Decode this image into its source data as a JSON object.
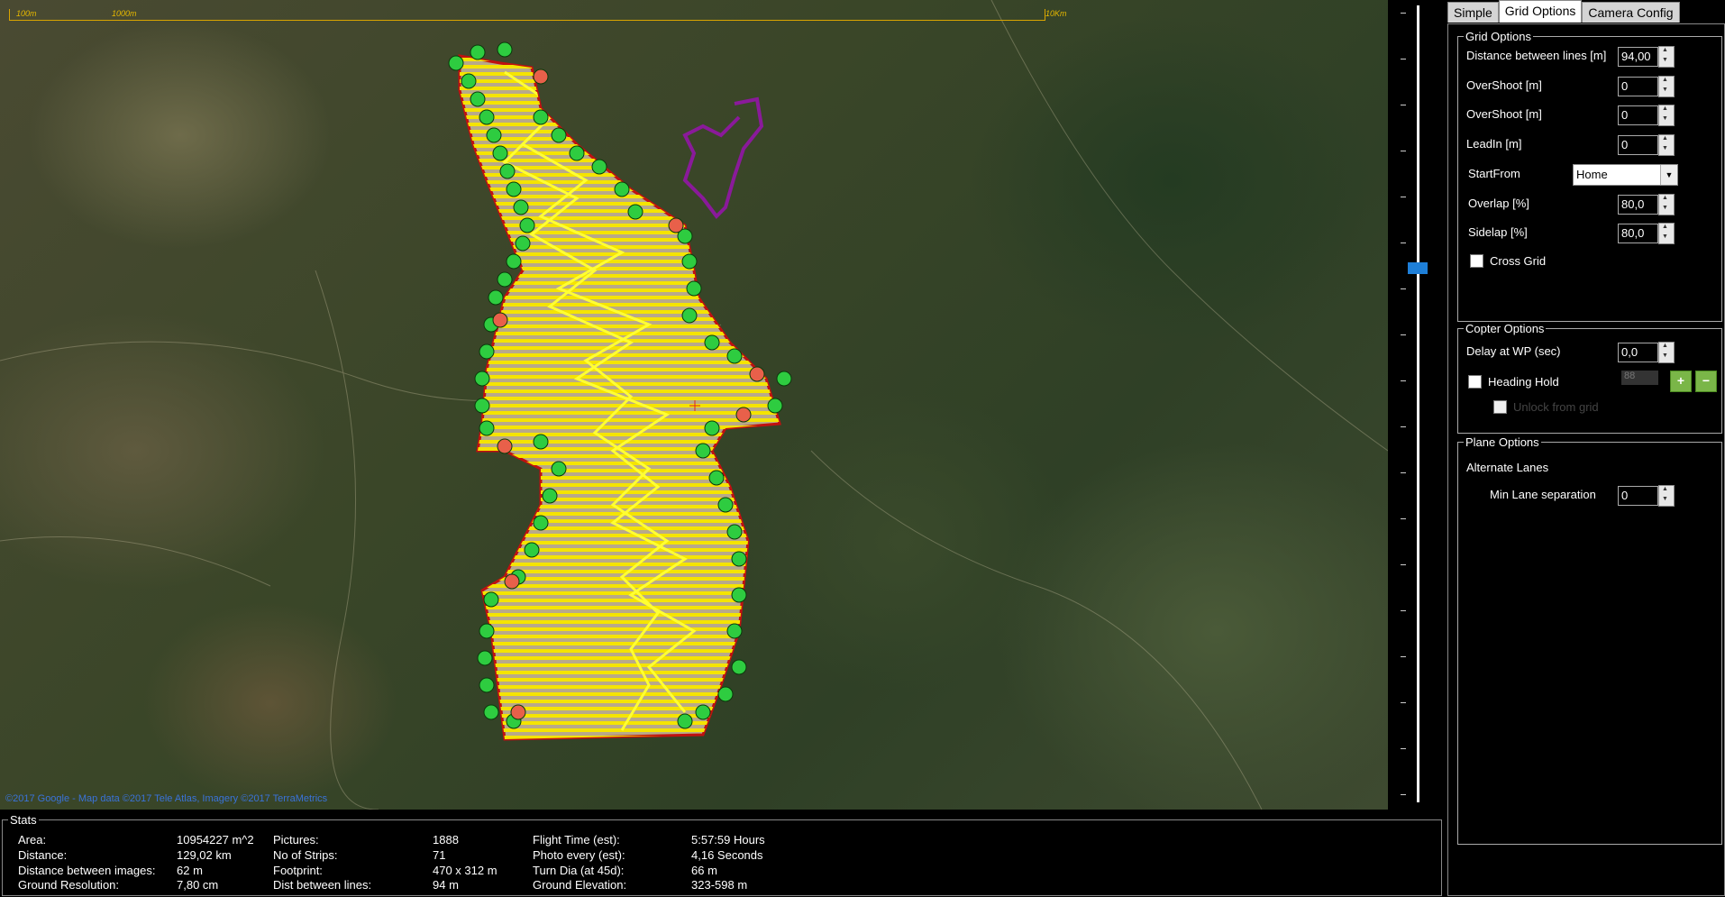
{
  "map": {
    "scale_labels": [
      "100m",
      "1000m",
      "10Km"
    ],
    "attribution": "©2017 Google - Map data ©2017 Tele Atlas, Imagery ©2017 TerraMetrics"
  },
  "tabs": [
    "Simple",
    "Grid Options",
    "Camera Config"
  ],
  "active_tab": "Grid Options",
  "grid_options": {
    "title": "Grid Options",
    "fields": [
      {
        "label": "Distance between lines [m]",
        "value": "94,00"
      },
      {
        "label": "OverShoot [m]",
        "value": "0"
      },
      {
        "label": "OverShoot [m]",
        "value": "0"
      },
      {
        "label": "LeadIn [m]",
        "value": "0"
      }
    ],
    "startfrom_label": "StartFrom",
    "startfrom_value": "Home",
    "overlap_label": "Overlap [%]",
    "overlap_value": "80,0",
    "sidelap_label": "Sidelap [%]",
    "sidelap_value": "80,0",
    "crossgrid_label": "Cross Grid"
  },
  "copter_options": {
    "title": "Copter Options",
    "delay_label": "Delay at WP (sec)",
    "delay_value": "0,0",
    "heading_hold_label": "Heading Hold",
    "heading_value": "88",
    "plus_label": "+",
    "minus_label": "−",
    "unlock_label": "Unlock from grid"
  },
  "plane_options": {
    "title": "Plane Options",
    "alternate_label": "Alternate Lanes",
    "min_lane_label": "Min Lane separation",
    "min_lane_value": "0"
  },
  "stats": {
    "title": "Stats",
    "col1": [
      {
        "label": "Area:",
        "value": "10954227 m^2"
      },
      {
        "label": "Distance:",
        "value": "129,02 km"
      },
      {
        "label": "Distance between images:",
        "value": "62 m"
      },
      {
        "label": "Ground Resolution:",
        "value": "7,80 cm"
      }
    ],
    "col2": [
      {
        "label": "Pictures:",
        "value": "1888"
      },
      {
        "label": "No of Strips:",
        "value": "71"
      },
      {
        "label": "Footprint:",
        "value": "470 x 312 m"
      },
      {
        "label": "Dist between lines:",
        "value": "94 m"
      }
    ],
    "col3": [
      {
        "label": "Flight Time (est):",
        "value": "5:57:59 Hours"
      },
      {
        "label": "Photo every (est):",
        "value": "4,16 Seconds"
      },
      {
        "label": "Turn Dia (at 45d):",
        "value": "66 m"
      },
      {
        "label": "Ground Elevation:",
        "value": "323-598 m"
      }
    ]
  },
  "colors": {
    "grid_lines": "#f5e400",
    "waypoint": "#2ecc40",
    "waypoint_start": "#e8604a",
    "track": "#8a1a9a",
    "zoom_thumb": "#1e7fd8"
  }
}
